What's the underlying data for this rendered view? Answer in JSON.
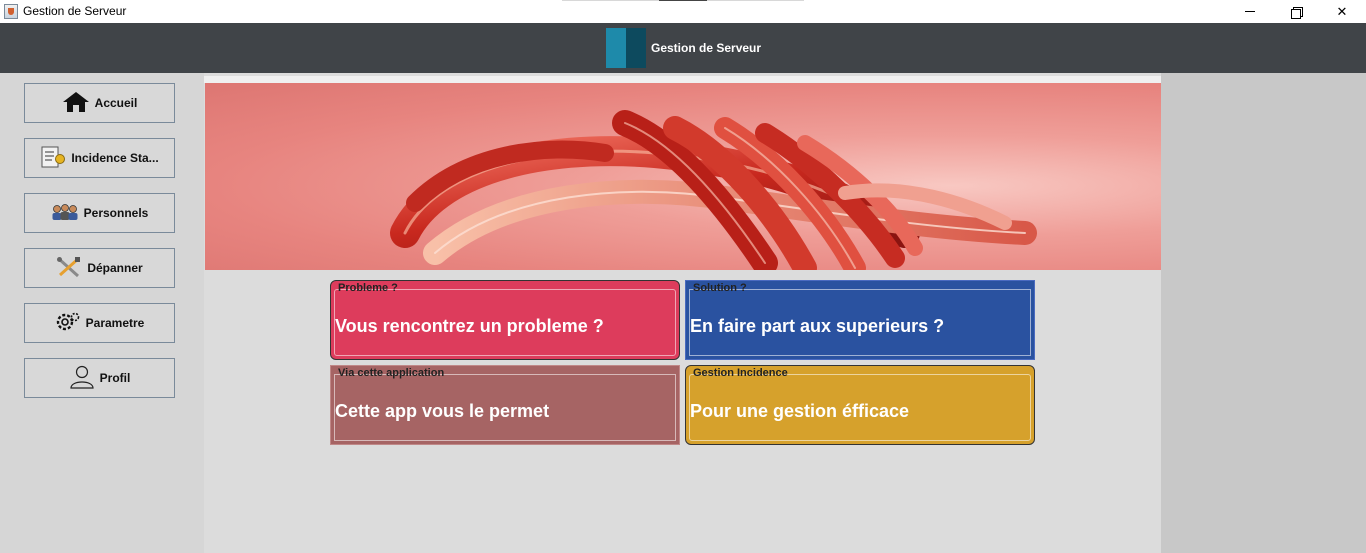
{
  "window": {
    "title": "Gestion de Serveur",
    "controls": {
      "minimize": "minimize-icon",
      "maximize": "restore-icon",
      "close": "✕"
    }
  },
  "header": {
    "title": "Gestion de Serveur"
  },
  "sidebar": {
    "items": [
      {
        "label": "Accueil",
        "icon": "home-icon"
      },
      {
        "label": "Incidence Sta...",
        "icon": "report-icon"
      },
      {
        "label": "Personnels",
        "icon": "people-icon"
      },
      {
        "label": "Dépanner",
        "icon": "tools-icon"
      },
      {
        "label": "Parametre",
        "icon": "settings-icon"
      },
      {
        "label": "Profil",
        "icon": "user-icon"
      }
    ]
  },
  "main": {
    "banner": {
      "image": "red-abstract-ribbon-banner"
    },
    "cards": [
      {
        "legend": "Probleme ?",
        "text": "Vous rencontrez un probleme ?",
        "color": "#dd3c5c"
      },
      {
        "legend": "Solution ?",
        "text": "En faire part aux superieurs ?",
        "color": "#2a52a0"
      },
      {
        "legend": "Via cette application",
        "text": "Cette app vous le permet",
        "color": "#a66464"
      },
      {
        "legend": "Gestion Incidence",
        "text": "Pour une gestion éfficace",
        "color": "#d6a12c"
      }
    ]
  },
  "colors": {
    "header_bg": "#404448",
    "sidebar_bg": "#d6d6d6",
    "main_bg": "#dcdcdc",
    "logo_light": "#1e8aaa",
    "logo_dark": "#0d4a5e"
  }
}
